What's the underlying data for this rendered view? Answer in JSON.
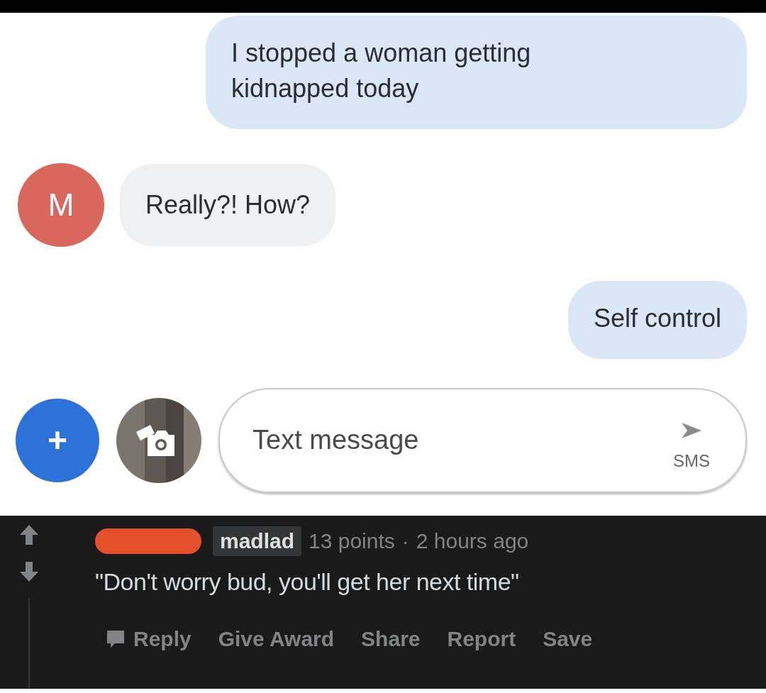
{
  "messages": [
    {
      "kind": "sent",
      "text": "I stopped a woman getting kidnapped today"
    },
    {
      "kind": "received",
      "avatar": "M",
      "text": "Really?! How?"
    },
    {
      "kind": "sent",
      "text": "Self control"
    }
  ],
  "composer": {
    "attach_label": "+",
    "placeholder": "Text message",
    "send_label": "SMS"
  },
  "comment": {
    "flair": "madlad",
    "points": "13 points",
    "separator": "·",
    "time": "2 hours ago",
    "body": "\"Don't worry bud, you'll get her next time\"",
    "actions": [
      "Reply",
      "Give Award",
      "Share",
      "Report",
      "Save"
    ]
  }
}
